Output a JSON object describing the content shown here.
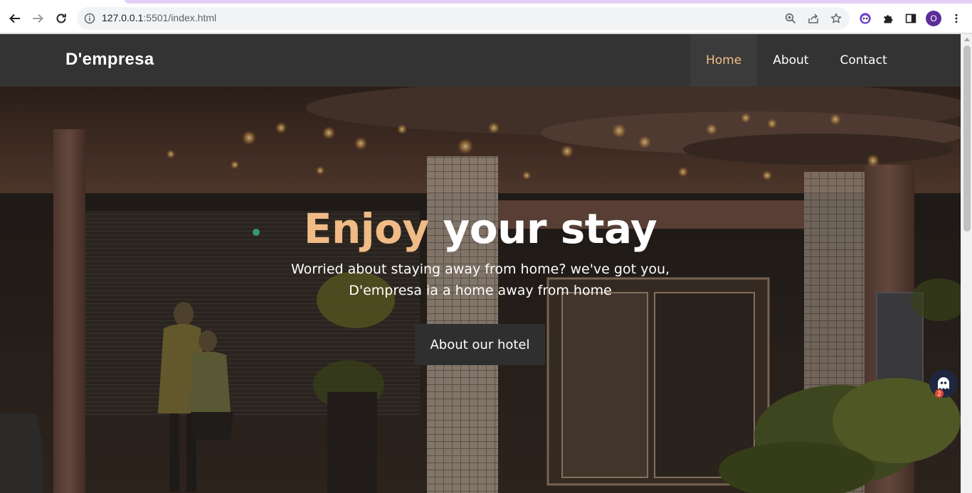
{
  "browser": {
    "url_host": "127.0.0.1",
    "url_path": ":5501/index.html",
    "profile_initial": "O",
    "icons": {
      "back": "back-arrow-icon",
      "forward": "forward-arrow-icon",
      "reload": "reload-icon",
      "info": "site-info-icon",
      "zoom": "zoom-icon",
      "share": "share-icon",
      "bookmark": "star-icon",
      "extension_ghost": "ghost-extension-icon",
      "extensions": "puzzle-icon",
      "side_panel": "side-panel-icon",
      "menu": "kebab-menu-icon"
    }
  },
  "site": {
    "brand": "D'empresa",
    "nav": [
      {
        "label": "Home",
        "active": true
      },
      {
        "label": "About",
        "active": false
      },
      {
        "label": "Contact",
        "active": false
      }
    ],
    "hero": {
      "title_accent": "Enjoy",
      "title_rest": " your stay",
      "subtitle_line1": "Worried about staying away from home? we've got you,",
      "subtitle_line2": "D'empresa ia a home away from home",
      "cta_label": "About our hotel"
    },
    "bubble_badge": "2"
  },
  "colors": {
    "nav_bg": "#333333",
    "accent": "#f0bb86",
    "cta_bg": "#2f2f2f"
  }
}
